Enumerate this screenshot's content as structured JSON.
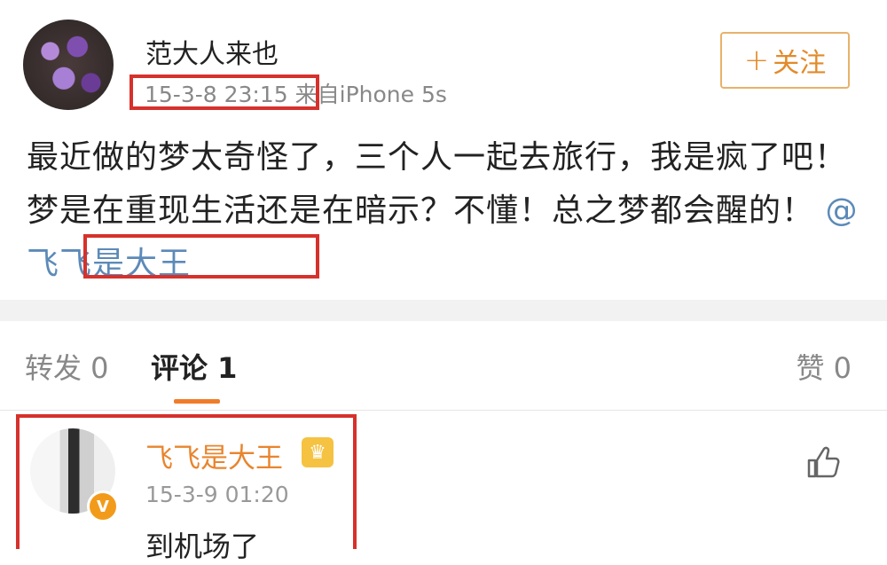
{
  "post": {
    "username": "范大人来也",
    "time": "15-3-8 23:15",
    "source": "来自iPhone 5s",
    "follow_label": "关注",
    "body_text": "最近做的梦太奇怪了，三个人一起去旅行，我是疯了吧！梦是在重现生活还是在暗示？不懂！总之梦都会醒的！",
    "mention": "@飞飞是大王"
  },
  "tabs": {
    "repost": "转发 0",
    "comment": "评论 1",
    "like": "赞 0"
  },
  "comment": {
    "username": "飞飞是大王",
    "time": "15-3-9 01:20",
    "text": "到机场了"
  },
  "icons": {
    "follow": "plus-icon",
    "badge": "verified-v-icon",
    "vip": "crown-icon",
    "like": "thumbs-up-icon"
  },
  "colors": {
    "accent": "#f07c2a",
    "mention": "#5c8ab8",
    "highlight_box": "#d6312c"
  }
}
